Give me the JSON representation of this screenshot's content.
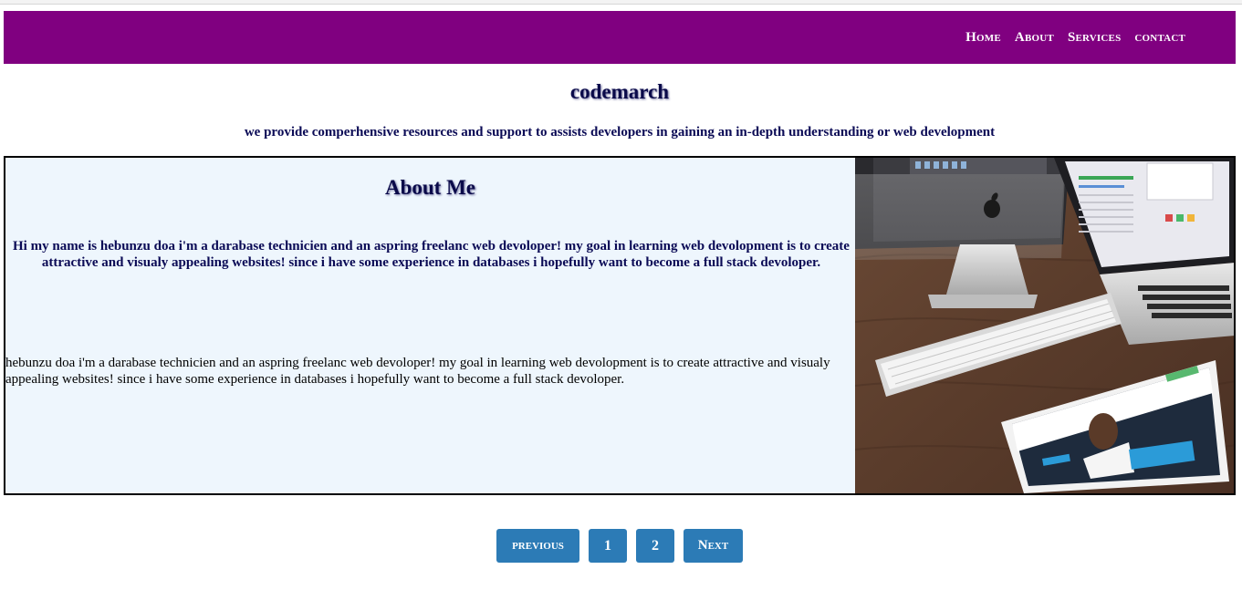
{
  "nav": {
    "links": [
      "Home",
      "About",
      "Services",
      "contact"
    ]
  },
  "header": {
    "title": "codemarch",
    "tagline": "we provide comperhensive resources and support to assists developers in gaining an in-depth understanding or web development"
  },
  "about": {
    "heading": "About Me",
    "bold_text": "Hi my name is hebunzu doa i'm a darabase technicien and an aspring freelanc web devoloper! my goal in learning web devolopment is to create attractive and visualy appealing websites! since i have some experience in databases i hopefully want to become a full stack devoloper.",
    "plain_text": "hebunzu doa i'm a darabase technicien and an aspring freelanc web devoloper! my goal in learning web devolopment is to create attractive and visualy appealing websites! since i have some experience in databases i hopefully want to become a full stack devoloper.",
    "image_icon": "workspace-photo-icon"
  },
  "pagination": {
    "previous": "previous",
    "page1": "1",
    "page2": "2",
    "next": "Next"
  },
  "colors": {
    "navbar": "#800080",
    "button": "#2c7bb6",
    "about_bg": "#eef6fd",
    "heading_text": "#0a0a4a"
  }
}
